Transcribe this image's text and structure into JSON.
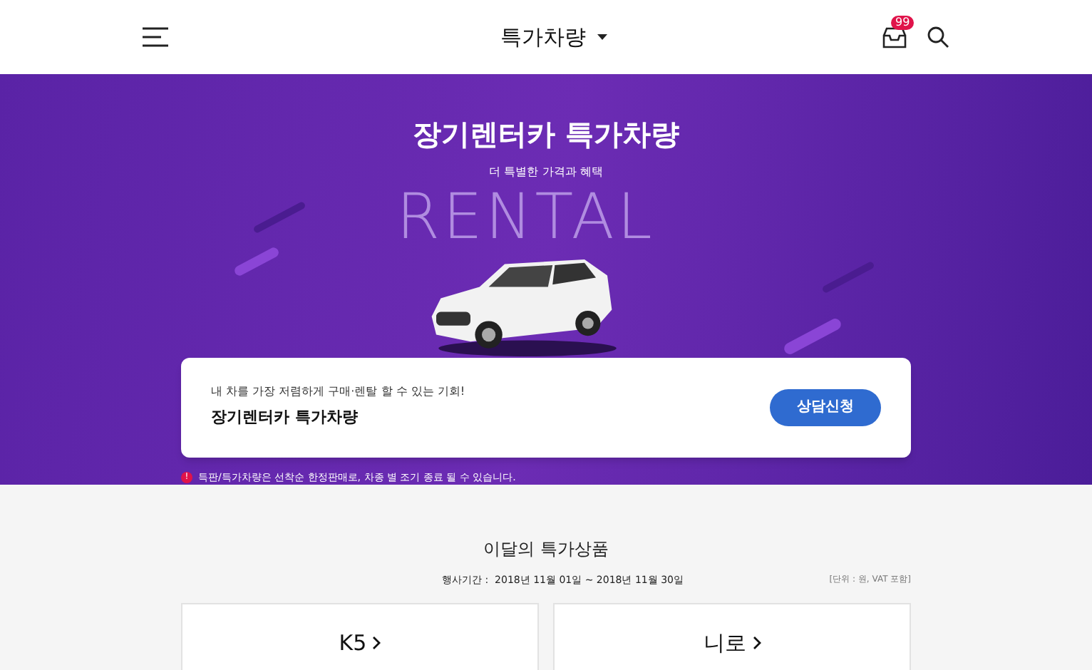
{
  "header": {
    "title": "특가차량",
    "badge": "99"
  },
  "hero": {
    "title": "장기렌터카 특가차량",
    "subtitle": "더 특별한 가격과 혜택",
    "backdrop_text": "RENTAL"
  },
  "promo_card": {
    "caption": "내 차를 가장 저렴하게 구매·렌탈 할 수 있는 기회!",
    "title": "장기렌터카 특가차량",
    "button": "상담신청"
  },
  "notice": {
    "icon": "!",
    "text": "특판/특가차량은 선착순 한정판매로, 차종 별 조기 종료 될 수 있습니다."
  },
  "section": {
    "title": "이달의 특가상품",
    "period": "행사기간 :  2018년 11월 01일 ~ 2018년 11월 30일",
    "unit": "[단위 : 원, VAT 포함]"
  },
  "products": [
    {
      "name": "K5"
    },
    {
      "name": "니로"
    }
  ]
}
